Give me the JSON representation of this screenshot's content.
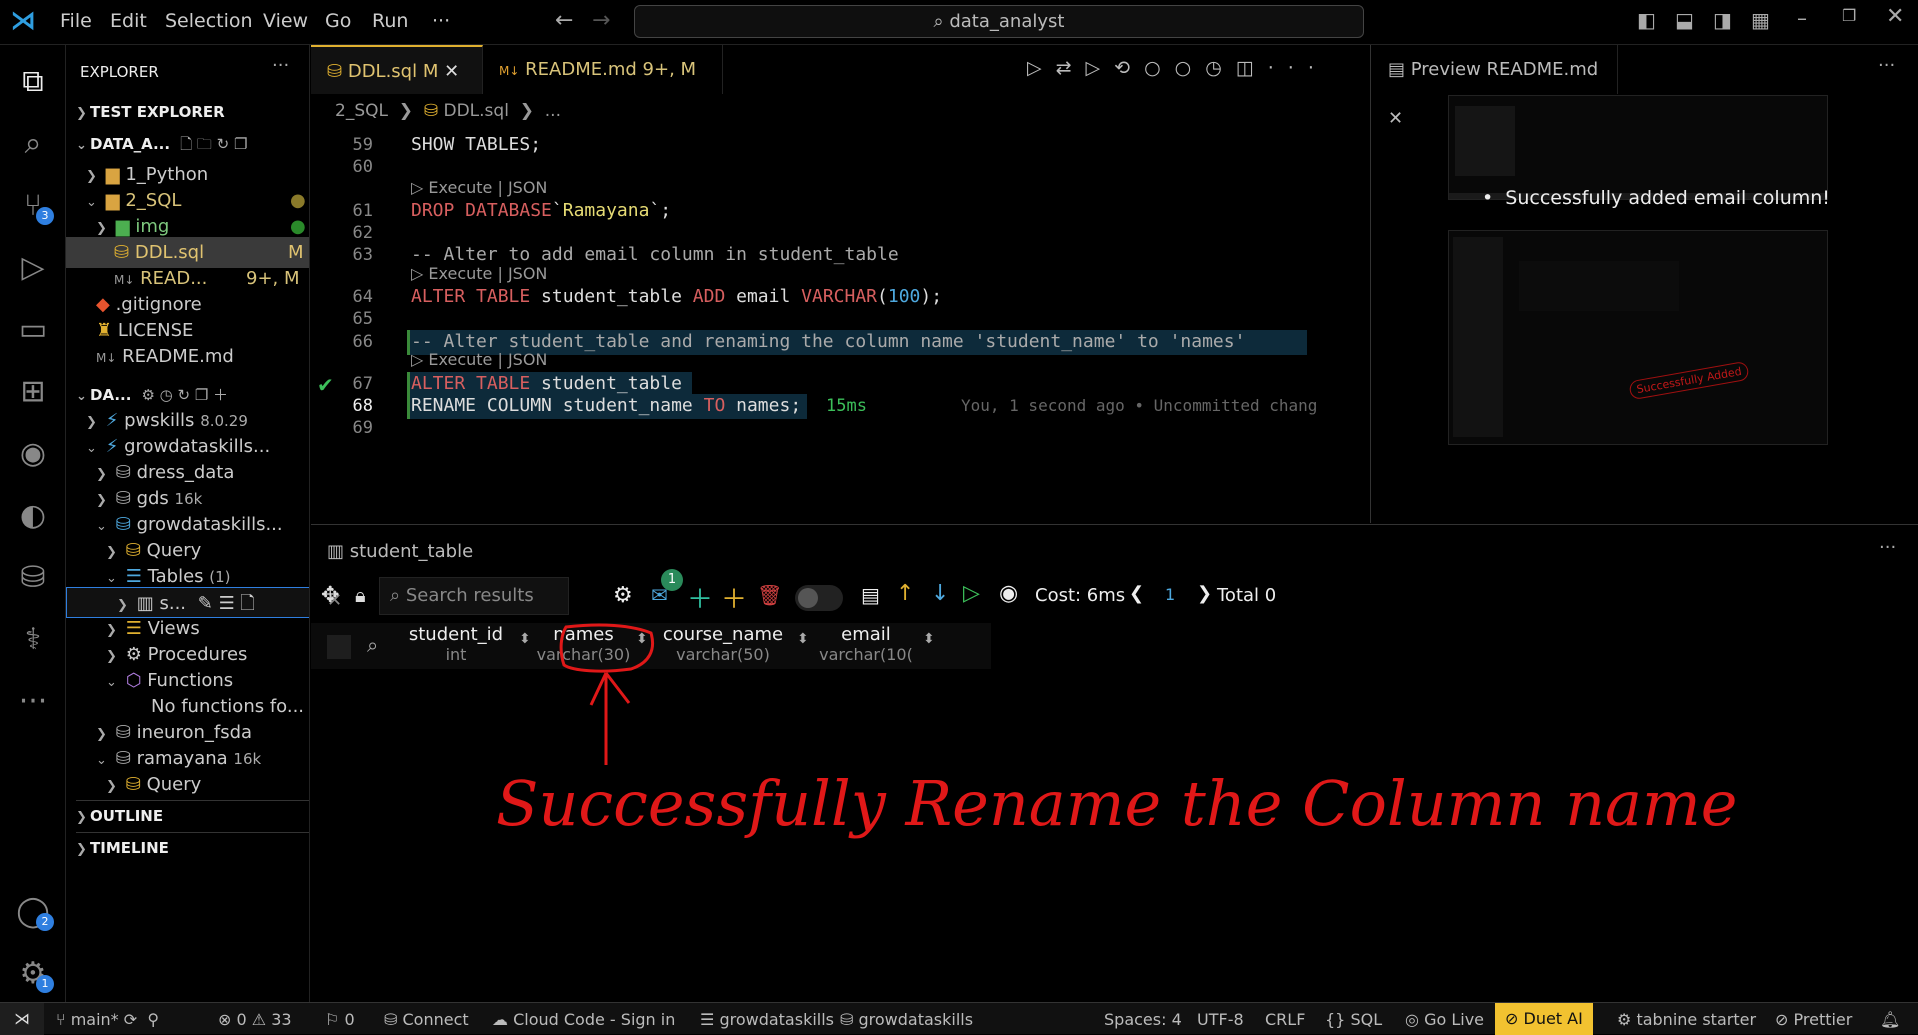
{
  "titlebar": {
    "menus": [
      "File",
      "Edit",
      "Selection",
      "View",
      "Go",
      "Run",
      "···"
    ],
    "search": "data_analyst"
  },
  "activity_badges": {
    "source_control": "3",
    "accounts": "2",
    "settings": "1"
  },
  "sidebar": {
    "title": "EXPLORER",
    "test_explorer": "TEST EXPLORER",
    "workspace": "DATA_A...",
    "files": [
      {
        "label": "1_Python"
      },
      {
        "label": "2_SQL"
      },
      {
        "label": "img"
      },
      {
        "label": "DDL.sql",
        "status": "M"
      },
      {
        "label": "READ...",
        "status": "9+, M"
      },
      {
        "label": ".gitignore"
      },
      {
        "label": "LICENSE"
      },
      {
        "label": "README.md"
      }
    ],
    "db_section": "DA...",
    "db_tree": [
      {
        "label": "pwskills",
        "meta": "8.0.29"
      },
      {
        "label": "growdataskills..."
      },
      {
        "label": "dress_data"
      },
      {
        "label": "gds",
        "meta": "16k"
      },
      {
        "label": "growdataskills..."
      },
      {
        "label": "Query"
      },
      {
        "label": "Tables",
        "meta": "(1)"
      },
      {
        "label": "s..."
      },
      {
        "label": "Views"
      },
      {
        "label": "Procedures"
      },
      {
        "label": "Functions"
      },
      {
        "label": "No functions fo..."
      },
      {
        "label": "ineuron_fsda"
      },
      {
        "label": "ramayana",
        "meta": "16k"
      },
      {
        "label": "Query"
      }
    ],
    "outline": "OUTLINE",
    "timeline": "TIMELINE"
  },
  "editor": {
    "tabs": [
      {
        "label": "DDL.sql",
        "status": "M"
      },
      {
        "label": "README.md",
        "status": "9+, M"
      }
    ],
    "breadcrumb": [
      "2_SQL",
      "DDL.sql",
      "..."
    ],
    "lens": "Execute | JSON",
    "lines": [
      {
        "n": "59",
        "text": "SHOW TABLES;"
      },
      {
        "n": "60",
        "text": ""
      },
      {
        "n": "61",
        "text": "DROP DATABASE`Ramayana`;"
      },
      {
        "n": "62",
        "text": ""
      },
      {
        "n": "63",
        "text": "-- Alter to add email column in student_table"
      },
      {
        "n": "64",
        "text": "ALTER TABLE student_table ADD email VARCHAR(100);"
      },
      {
        "n": "65",
        "text": ""
      },
      {
        "n": "66",
        "text": "-- Alter student_table and renaming the column name 'student_name' to 'names'"
      },
      {
        "n": "67",
        "text": "ALTER TABLE student_table"
      },
      {
        "n": "68",
        "text": "RENAME COLUMN student_name TO names;"
      },
      {
        "n": "69",
        "text": ""
      }
    ],
    "exec_time": "15ms",
    "blame": "You, 1 second ago • Uncommitted chang"
  },
  "preview": {
    "tab": "Preview README.md",
    "bullet": "Successfully added email column!",
    "thumb_text": "Successfully Added"
  },
  "panel": {
    "tab": "student_table",
    "search_placeholder": "Search results",
    "notif": "1",
    "cost": "Cost: 6ms",
    "page": "1",
    "total": "Total 0",
    "columns": [
      {
        "name": "student_id",
        "type": "int"
      },
      {
        "name": "names",
        "type": "varchar(30)"
      },
      {
        "name": "course_name",
        "type": "varchar(50)"
      },
      {
        "name": "email",
        "type": "varchar(10("
      }
    ],
    "annotation": "Successfully Rename the Column name"
  },
  "status": {
    "branch": "main*",
    "errors": "0",
    "warnings": "33",
    "ports": "0",
    "connect": "Connect",
    "cloud": "Cloud Code - Sign in",
    "db1": "growdataskills",
    "db2": "growdataskills",
    "spaces": "Spaces: 4",
    "encoding": "UTF-8",
    "eol": "CRLF",
    "lang": "SQL",
    "golive": "Go Live",
    "duet": "Duet AI",
    "tabnine": "tabnine starter",
    "prettier": "Prettier"
  },
  "colors": {
    "accent": "#2f7fe0",
    "annotation": "#e01818",
    "keyword": "#d75f5f",
    "duet_bg": "#f2c230"
  }
}
